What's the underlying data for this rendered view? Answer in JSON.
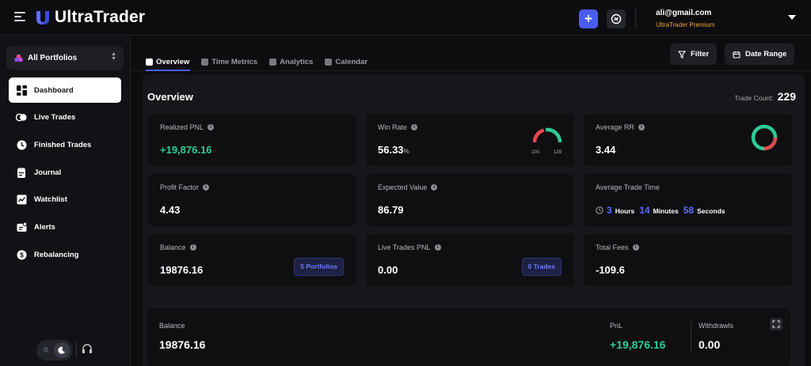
{
  "app": {
    "name": "UltraTrader"
  },
  "user": {
    "email": "ali@gmail.com",
    "plan": "UltraTrader Premium",
    "plan_color": "#f0a33a"
  },
  "header": {
    "add_label": "+"
  },
  "sidebar": {
    "portfolio_selector": "All Portfolios",
    "items": [
      {
        "label": "Dashboard",
        "icon": "dashboard-icon",
        "active": true
      },
      {
        "label": "Live Trades",
        "icon": "live-trades-icon"
      },
      {
        "label": "Finished Trades",
        "icon": "clock-icon"
      },
      {
        "label": "Journal",
        "icon": "journal-icon"
      },
      {
        "label": "Watchlist",
        "icon": "watchlist-icon"
      },
      {
        "label": "Alerts",
        "icon": "alerts-icon"
      },
      {
        "label": "Rebalancing",
        "icon": "dollar-icon"
      }
    ]
  },
  "tabs": [
    {
      "label": "Overview",
      "active": true
    },
    {
      "label": "Time Metrics"
    },
    {
      "label": "Analytics"
    },
    {
      "label": "Calendar"
    }
  ],
  "toolbar": {
    "filter_label": "Filter",
    "date_range_label": "Date Range"
  },
  "overview": {
    "title": "Overview",
    "trade_count_label": "Trade Count:",
    "trade_count": "229",
    "cards": {
      "realized_pnl": {
        "label": "Realized PNL",
        "value": "+19,876.16"
      },
      "win_rate": {
        "label": "Win Rate",
        "value": "56.33",
        "unit": "%",
        "gauge_left": "100",
        "gauge_right": "129",
        "win_fraction": 0.4367
      },
      "average_rr": {
        "label": "Average RR",
        "value": "3.44"
      },
      "profit_factor": {
        "label": "Profit Factor",
        "value": "4.43"
      },
      "expected_value": {
        "label": "Expected Value",
        "value": "86.79"
      },
      "average_trade_time": {
        "label": "Average Trade Time",
        "hours": "3",
        "hours_label": "Hours",
        "minutes": "14",
        "minutes_label": "Minutes",
        "seconds": "58",
        "seconds_label": "Seconds"
      },
      "balance": {
        "label": "Balance",
        "value": "19876.16",
        "badge": "5 Portfolios"
      },
      "live_trades_pnl": {
        "label": "Live Trades PNL",
        "value": "0.00",
        "badge": "0 Trades"
      },
      "total_fees": {
        "label": "Total Fees",
        "value": "-109.6"
      }
    }
  },
  "balance_panel": {
    "balance_label": "Balance",
    "balance_value": "19876.16",
    "pnl_label": "PnL",
    "pnl_value": "+19,876.16",
    "withdrawls_label": "Withdrawls",
    "withdrawls_value": "0.00"
  },
  "colors": {
    "accent": "#4a5cf0",
    "positive": "#2ecc93",
    "negative": "#e5484d"
  }
}
